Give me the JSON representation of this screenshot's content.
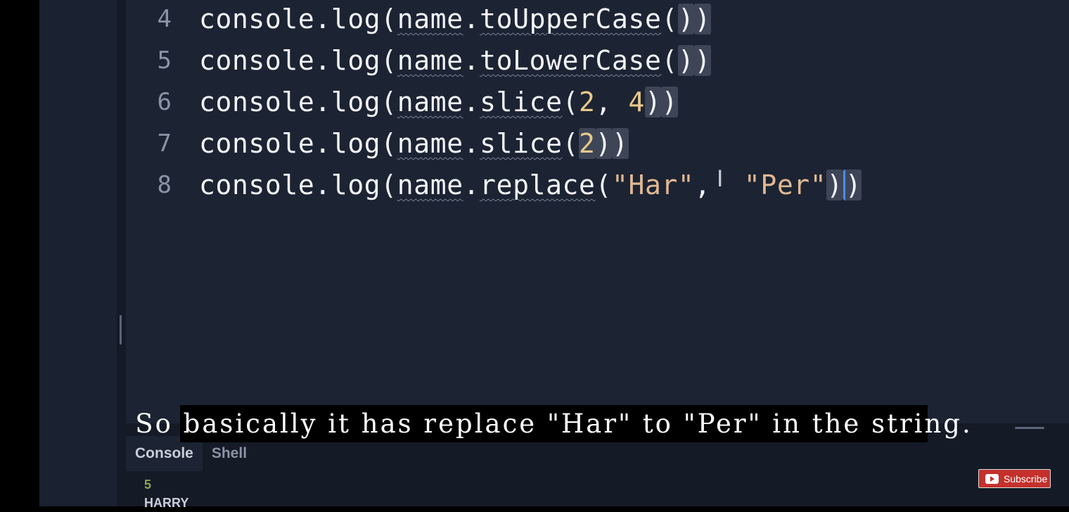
{
  "editor": {
    "lines": [
      {
        "num": "4",
        "text": "console.log(name.toUpperCase())"
      },
      {
        "num": "5",
        "text": "console.log(name.toLowerCase())"
      },
      {
        "num": "6",
        "text": "console.log(name.slice(2, 4))"
      },
      {
        "num": "7",
        "text": "console.log(name.slice(2))"
      },
      {
        "num": "8",
        "text": "console.log(name.replace(\"Har\", \"Per\"))"
      }
    ],
    "tokens": {
      "console": "console",
      "dot": ".",
      "log": "log",
      "paren_open": "(",
      "name": "name",
      "to_upper": "toUpperCase",
      "to_lower": "toLowerCase",
      "slice": "slice",
      "replace": "replace",
      "paren_close": ")",
      "num_2": "2",
      "comma_space": ", ",
      "num_4": "4",
      "str_har": "\"Har\"",
      "comma": ",",
      "str_per": "\"Per\""
    }
  },
  "bottom_panel": {
    "tabs": [
      "Console",
      "Shell"
    ],
    "output": [
      "5",
      "HARRY"
    ]
  },
  "caption": "So basically it has replace \"Har\" to \"Per\" in the string.",
  "subscribe": {
    "label": "Subscribe"
  }
}
